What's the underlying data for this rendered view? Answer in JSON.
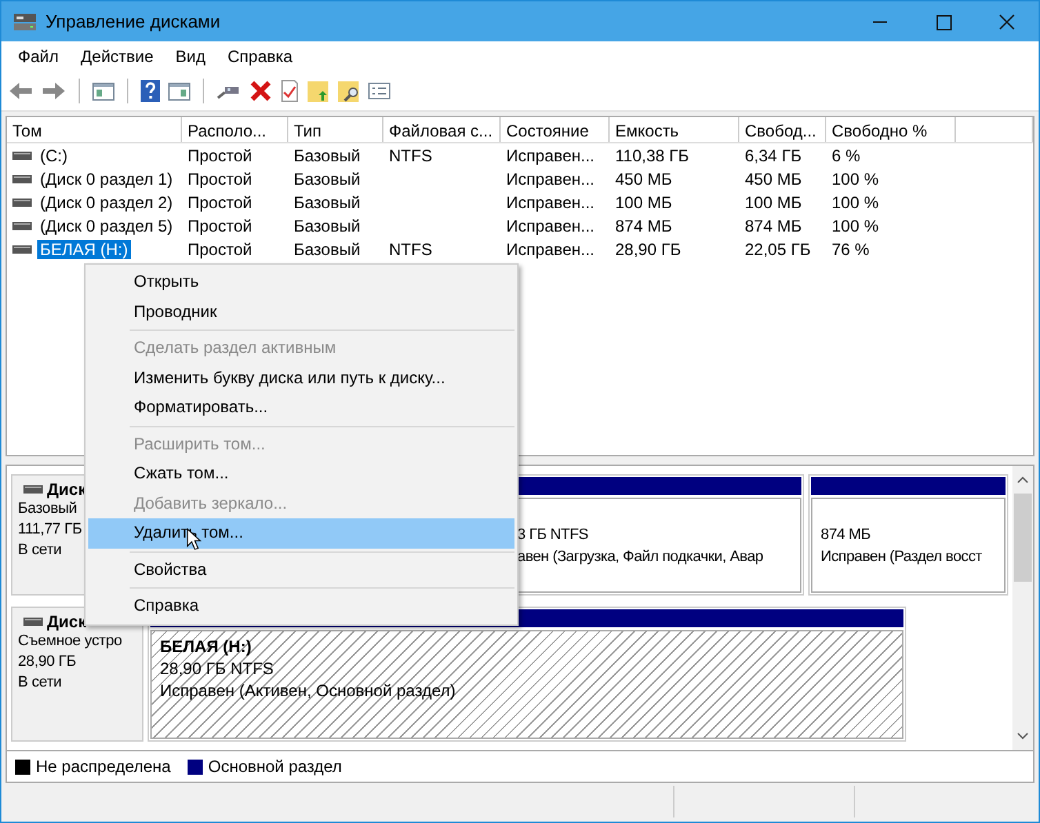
{
  "window": {
    "title": "Управление дисками"
  },
  "menu": [
    "Файл",
    "Действие",
    "Вид",
    "Справка"
  ],
  "table": {
    "columns": [
      "Том",
      "Располо...",
      "Тип",
      "Файловая с...",
      "Состояние",
      "Емкость",
      "Свобод...",
      "Свободно %"
    ],
    "rows": [
      {
        "selected": false,
        "cells": [
          "(C:)",
          "Простой",
          "Базовый",
          "NTFS",
          "Исправен...",
          "110,38 ГБ",
          "6,34 ГБ",
          "6 %"
        ]
      },
      {
        "selected": false,
        "cells": [
          "(Диск 0 раздел 1)",
          "Простой",
          "Базовый",
          "",
          "Исправен...",
          "450 МБ",
          "450 МБ",
          "100 %"
        ]
      },
      {
        "selected": false,
        "cells": [
          "(Диск 0 раздел 2)",
          "Простой",
          "Базовый",
          "",
          "Исправен...",
          "100 МБ",
          "100 МБ",
          "100 %"
        ]
      },
      {
        "selected": false,
        "cells": [
          "(Диск 0 раздел 5)",
          "Простой",
          "Базовый",
          "",
          "Исправен...",
          "874 МБ",
          "874 МБ",
          "100 %"
        ]
      },
      {
        "selected": true,
        "cells": [
          "БЕЛАЯ (H:)",
          "Простой",
          "Базовый",
          "NTFS",
          "Исправен...",
          "28,90 ГБ",
          "22,05 ГБ",
          "76 %"
        ]
      }
    ]
  },
  "disks": [
    {
      "name": "Диск",
      "lines": [
        "Базовый",
        "111,77 ГБ",
        "В сети"
      ],
      "partitions": [
        {
          "selected": false,
          "lines": [
            "3 ГБ NTFS",
            "авен (Загрузка, Файл подкачки, Авар"
          ]
        },
        {
          "selected": false,
          "lines": [
            "874 МБ",
            "Исправен (Раздел восст"
          ]
        }
      ]
    },
    {
      "name": "Диск",
      "lines": [
        "Съемное устро",
        "28,90 ГБ",
        "В сети"
      ],
      "partitions": [
        {
          "selected": true,
          "title": "БЕЛАЯ  (H:)",
          "lines": [
            "28,90 ГБ NTFS",
            "Исправен (Активен, Основной раздел)"
          ]
        }
      ]
    }
  ],
  "legend": [
    {
      "label": "Не распределена",
      "color": "#000000"
    },
    {
      "label": "Основной раздел",
      "color": "#000080"
    }
  ],
  "context_menu": [
    {
      "kind": "item",
      "label": "Открыть",
      "disabled": false,
      "selected": false
    },
    {
      "kind": "item",
      "label": "Проводник",
      "disabled": false,
      "selected": false
    },
    {
      "kind": "separator"
    },
    {
      "kind": "item",
      "label": "Сделать раздел активным",
      "disabled": true,
      "selected": false
    },
    {
      "kind": "item",
      "label": "Изменить букву диска или путь к диску...",
      "disabled": false,
      "selected": false
    },
    {
      "kind": "item",
      "label": "Форматировать...",
      "disabled": false,
      "selected": false
    },
    {
      "kind": "separator"
    },
    {
      "kind": "item",
      "label": "Расширить том...",
      "disabled": true,
      "selected": false
    },
    {
      "kind": "item",
      "label": "Сжать том...",
      "disabled": false,
      "selected": false
    },
    {
      "kind": "item",
      "label": "Добавить зеркало...",
      "disabled": true,
      "selected": false
    },
    {
      "kind": "item",
      "label": "Удалить том...",
      "disabled": false,
      "selected": true
    },
    {
      "kind": "separator"
    },
    {
      "kind": "item",
      "label": "Свойства",
      "disabled": false,
      "selected": false
    },
    {
      "kind": "separator"
    },
    {
      "kind": "item",
      "label": "Справка",
      "disabled": false,
      "selected": false
    }
  ]
}
